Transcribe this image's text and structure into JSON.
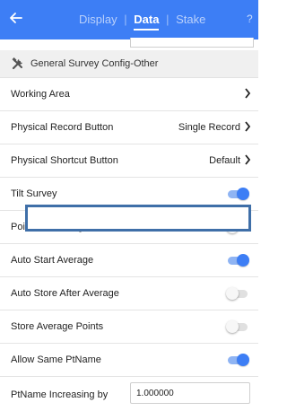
{
  "header": {
    "tabs": [
      "Display",
      "Data",
      "Stake"
    ],
    "active_tab": "Data",
    "help": "?",
    "accent_color": "#3d7ef5"
  },
  "section": {
    "title": "General Survey Config-Other",
    "icon": "tools-icon"
  },
  "rows": [
    {
      "label": "Working Area",
      "value": "",
      "control": "chevron"
    },
    {
      "label": "Physical Record Button",
      "value": "Single Record",
      "control": "chevron"
    },
    {
      "label": "Physical Shortcut Button",
      "value": "Default",
      "control": "chevron"
    },
    {
      "label": "Tilt Survey",
      "control": "toggle",
      "on": true
    },
    {
      "label": "Point Info Dialog",
      "control": "toggle",
      "on": false
    },
    {
      "label": "Auto Start Average",
      "control": "toggle",
      "on": true
    },
    {
      "label": "Auto Store After Average",
      "control": "toggle",
      "on": false
    },
    {
      "label": "Store Average Points",
      "control": "toggle",
      "on": false
    },
    {
      "label": "Allow Same PtName",
      "control": "toggle",
      "on": true
    },
    {
      "label": "PtName Increasing by",
      "control": "input",
      "value": "1.000000"
    }
  ]
}
